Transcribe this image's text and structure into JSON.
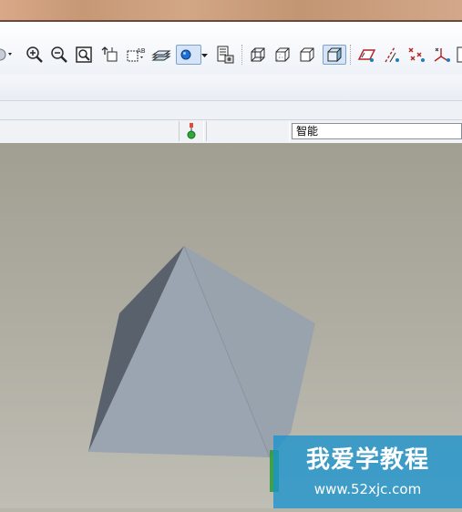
{
  "toolbar": {
    "buttons": [
      {
        "icon": "view-style-dropdown-icon"
      },
      {
        "icon": "zoom-in-icon"
      },
      {
        "icon": "zoom-out-icon"
      },
      {
        "icon": "refit-icon"
      },
      {
        "icon": "reorient-icon"
      },
      {
        "icon": "saved-views-icon"
      },
      {
        "icon": "layers-icon"
      },
      {
        "icon": "display-style-icon"
      },
      {
        "icon": "view-manager-icon"
      },
      {
        "icon": "wireframe-icon"
      },
      {
        "icon": "hidden-line-icon"
      },
      {
        "icon": "no-hidden-icon"
      },
      {
        "icon": "shading-icon"
      },
      {
        "icon": "datum-planes-icon"
      },
      {
        "icon": "datum-axes-icon"
      },
      {
        "icon": "datum-points-icon"
      },
      {
        "icon": "coordinate-systems-icon"
      }
    ]
  },
  "statusbar": {
    "filter_value": "智能"
  },
  "watermark": {
    "title": "我爱学教程",
    "url": "www.52xjc.com",
    "color": "#1a94cd"
  },
  "colors": {
    "viewport_top": "#a19f92",
    "viewport_bottom": "#bfbeb4",
    "pyramid_light": "#98a3ae",
    "pyramid_dark": "#59626c"
  }
}
